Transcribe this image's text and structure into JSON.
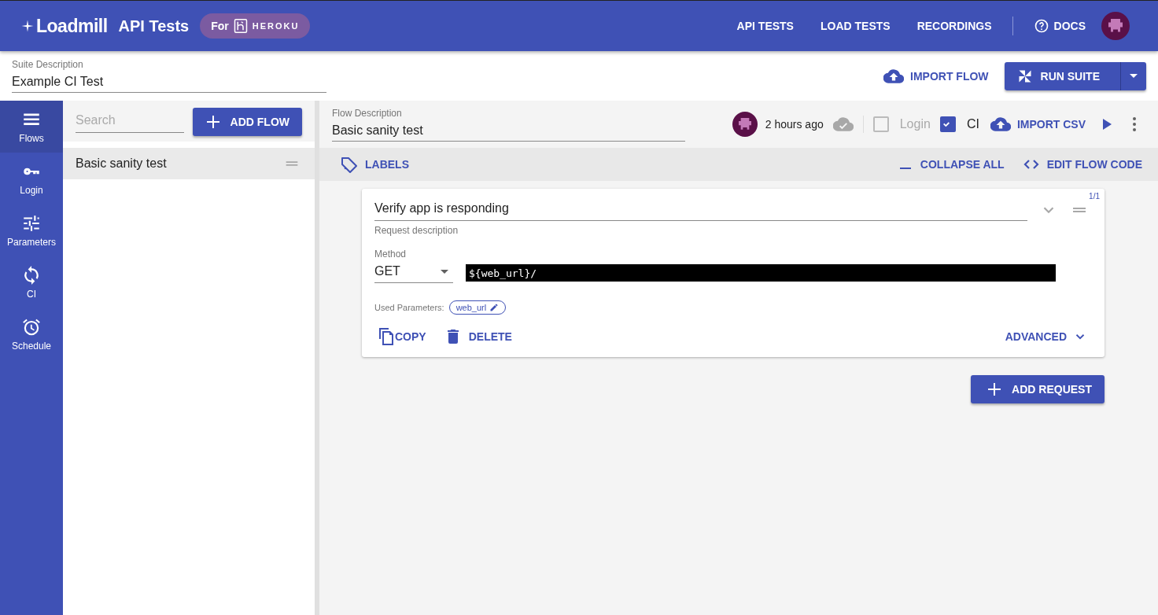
{
  "header": {
    "logo": "Loadmill",
    "product": "API Tests",
    "badge_prefix": "For",
    "badge_brand": "HEROKU",
    "nav": [
      {
        "label": "API TESTS"
      },
      {
        "label": "LOAD TESTS"
      },
      {
        "label": "RECORDINGS"
      }
    ],
    "docs": "DOCS"
  },
  "suite": {
    "label": "Suite Description",
    "value": "Example CI Test",
    "import_flow": "IMPORT FLOW",
    "run_suite": "RUN SUITE"
  },
  "sidebar": {
    "items": [
      {
        "label": "Flows",
        "kind": "flows",
        "selected": true
      },
      {
        "label": "Login",
        "kind": "login",
        "selected": false
      },
      {
        "label": "Parameters",
        "kind": "parameters",
        "selected": false
      },
      {
        "label": "CI",
        "kind": "ci",
        "selected": false
      },
      {
        "label": "Schedule",
        "kind": "schedule",
        "selected": false
      }
    ]
  },
  "flows": {
    "search_placeholder": "Search",
    "add_flow": "ADD FLOW",
    "items": [
      {
        "label": "Basic sanity test",
        "selected": true
      }
    ]
  },
  "flow": {
    "label": "Flow Description",
    "value": "Basic sanity test",
    "updated": "2 hours ago",
    "options": [
      {
        "label": "Login",
        "checked": false
      },
      {
        "label": "CI",
        "checked": true
      }
    ],
    "import_csv": "IMPORT CSV",
    "labels": "LABELS",
    "collapse_all": "COLLAPSE ALL",
    "edit_code": "EDIT FLOW CODE"
  },
  "requests": [
    {
      "counter": "1/1",
      "description": "Verify app is responding",
      "description_label": "Request description",
      "method_label": "Method",
      "method": "GET",
      "url": "${web_url}/",
      "params_label": "Used Parameters:",
      "params": [
        "web_url"
      ],
      "copy": "COPY",
      "delete": "DELETE",
      "advanced": "ADVANCED"
    }
  ],
  "add_request": "ADD REQUEST"
}
